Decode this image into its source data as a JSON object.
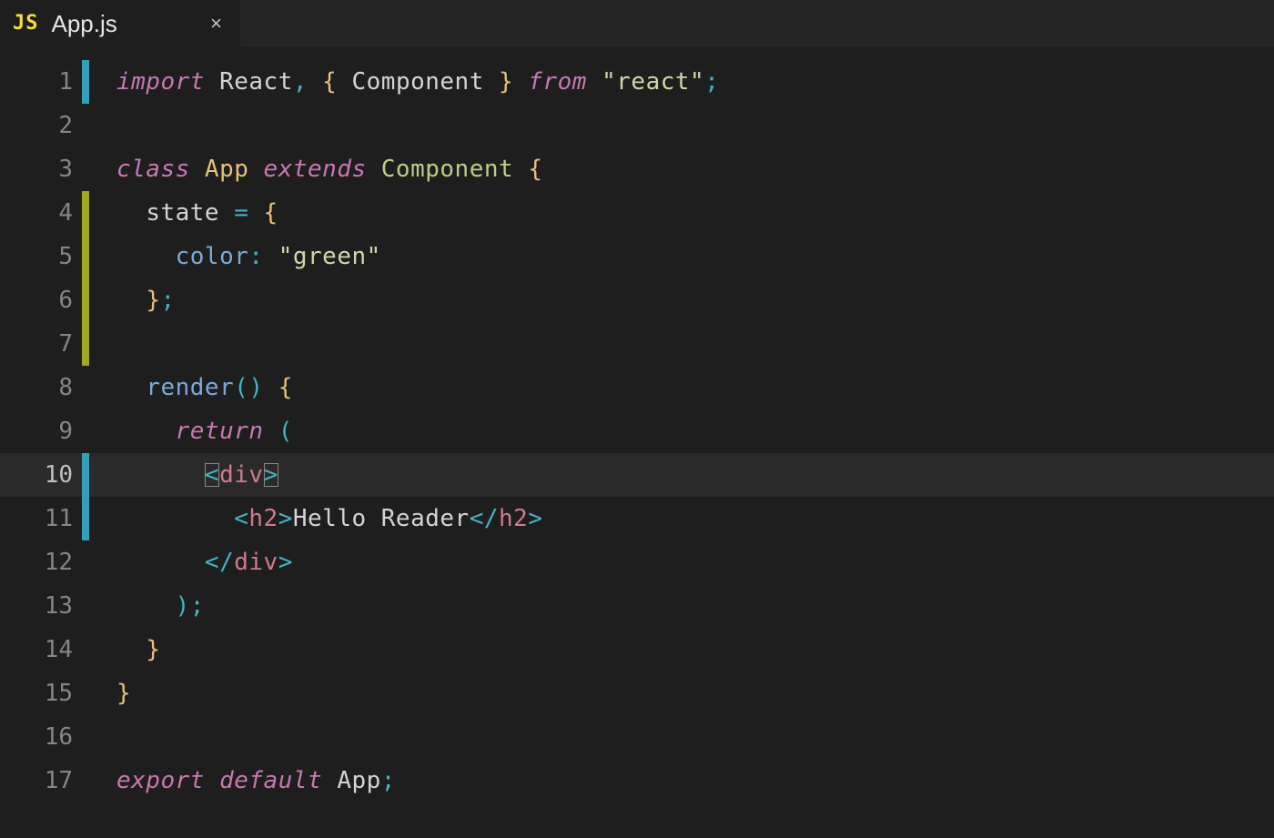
{
  "tab": {
    "lang_badge": "JS",
    "filename": "App.js",
    "close_glyph": "×"
  },
  "editor": {
    "active_line": 10,
    "gutter_marks": {
      "1": "cyan",
      "4": "green",
      "5": "green",
      "6": "green",
      "7": "green",
      "10": "cyan",
      "11": "cyan"
    },
    "lines": [
      {
        "n": 1,
        "indent": 0,
        "tokens": [
          {
            "t": "import ",
            "c": "tok-kw it"
          },
          {
            "t": "React",
            "c": "tok-def"
          },
          {
            "t": ", ",
            "c": "tok-pun"
          },
          {
            "t": "{ ",
            "c": "tok-curly"
          },
          {
            "t": "Component",
            "c": "tok-def"
          },
          {
            "t": " } ",
            "c": "tok-curly"
          },
          {
            "t": "from ",
            "c": "tok-kw it"
          },
          {
            "t": "\"react\"",
            "c": "tok-str"
          },
          {
            "t": ";",
            "c": "tok-pun"
          }
        ]
      },
      {
        "n": 2,
        "indent": 0,
        "tokens": []
      },
      {
        "n": 3,
        "indent": 0,
        "tokens": [
          {
            "t": "class ",
            "c": "tok-kw it"
          },
          {
            "t": "App ",
            "c": "tok-classname"
          },
          {
            "t": "extends ",
            "c": "tok-kw it"
          },
          {
            "t": "Component ",
            "c": "tok-type"
          },
          {
            "t": "{",
            "c": "tok-curly"
          }
        ]
      },
      {
        "n": 4,
        "indent": 1,
        "tokens": [
          {
            "t": "state ",
            "c": "tok-def"
          },
          {
            "t": "= ",
            "c": "tok-pun"
          },
          {
            "t": "{",
            "c": "tok-curly"
          }
        ]
      },
      {
        "n": 5,
        "indent": 2,
        "tokens": [
          {
            "t": "color",
            "c": "tok-prop"
          },
          {
            "t": ": ",
            "c": "tok-pun"
          },
          {
            "t": "\"green\"",
            "c": "tok-str"
          }
        ]
      },
      {
        "n": 6,
        "indent": 1,
        "tokens": [
          {
            "t": "}",
            "c": "tok-curly"
          },
          {
            "t": ";",
            "c": "tok-pun"
          }
        ]
      },
      {
        "n": 7,
        "indent": 0,
        "tokens": []
      },
      {
        "n": 8,
        "indent": 1,
        "tokens": [
          {
            "t": "render",
            "c": "tok-func"
          },
          {
            "t": "() ",
            "c": "tok-pun"
          },
          {
            "t": "{",
            "c": "tok-curly"
          }
        ]
      },
      {
        "n": 9,
        "indent": 2,
        "tokens": [
          {
            "t": "return ",
            "c": "tok-kw it"
          },
          {
            "t": "(",
            "c": "tok-pun"
          }
        ]
      },
      {
        "n": 10,
        "indent": 3,
        "tokens": [
          {
            "t": "<",
            "c": "tok-tagbr bracket-match"
          },
          {
            "t": "div",
            "c": "tok-tagname"
          },
          {
            "t": ">",
            "c": "tok-tagbr bracket-match"
          }
        ]
      },
      {
        "n": 11,
        "indent": 4,
        "tokens": [
          {
            "t": "<",
            "c": "tok-tagbr"
          },
          {
            "t": "h2",
            "c": "tok-tagname"
          },
          {
            "t": ">",
            "c": "tok-tagbr"
          },
          {
            "t": "Hello Reader",
            "c": "tok-text"
          },
          {
            "t": "</",
            "c": "tok-tagbr"
          },
          {
            "t": "h2",
            "c": "tok-tagname"
          },
          {
            "t": ">",
            "c": "tok-tagbr"
          }
        ]
      },
      {
        "n": 12,
        "indent": 3,
        "tokens": [
          {
            "t": "</",
            "c": "tok-tagbr"
          },
          {
            "t": "div",
            "c": "tok-tagname"
          },
          {
            "t": ">",
            "c": "tok-tagbr"
          }
        ]
      },
      {
        "n": 13,
        "indent": 2,
        "tokens": [
          {
            "t": ")",
            "c": "tok-pun"
          },
          {
            "t": ";",
            "c": "tok-pun"
          }
        ]
      },
      {
        "n": 14,
        "indent": 1,
        "tokens": [
          {
            "t": "}",
            "c": "tok-curly"
          }
        ]
      },
      {
        "n": 15,
        "indent": 0,
        "tokens": [
          {
            "t": "}",
            "c": "tok-curly"
          }
        ]
      },
      {
        "n": 16,
        "indent": 0,
        "tokens": []
      },
      {
        "n": 17,
        "indent": 0,
        "tokens": [
          {
            "t": "export ",
            "c": "tok-kw it"
          },
          {
            "t": "default ",
            "c": "tok-kw it"
          },
          {
            "t": "App",
            "c": "tok-def"
          },
          {
            "t": ";",
            "c": "tok-pun"
          }
        ]
      }
    ]
  }
}
